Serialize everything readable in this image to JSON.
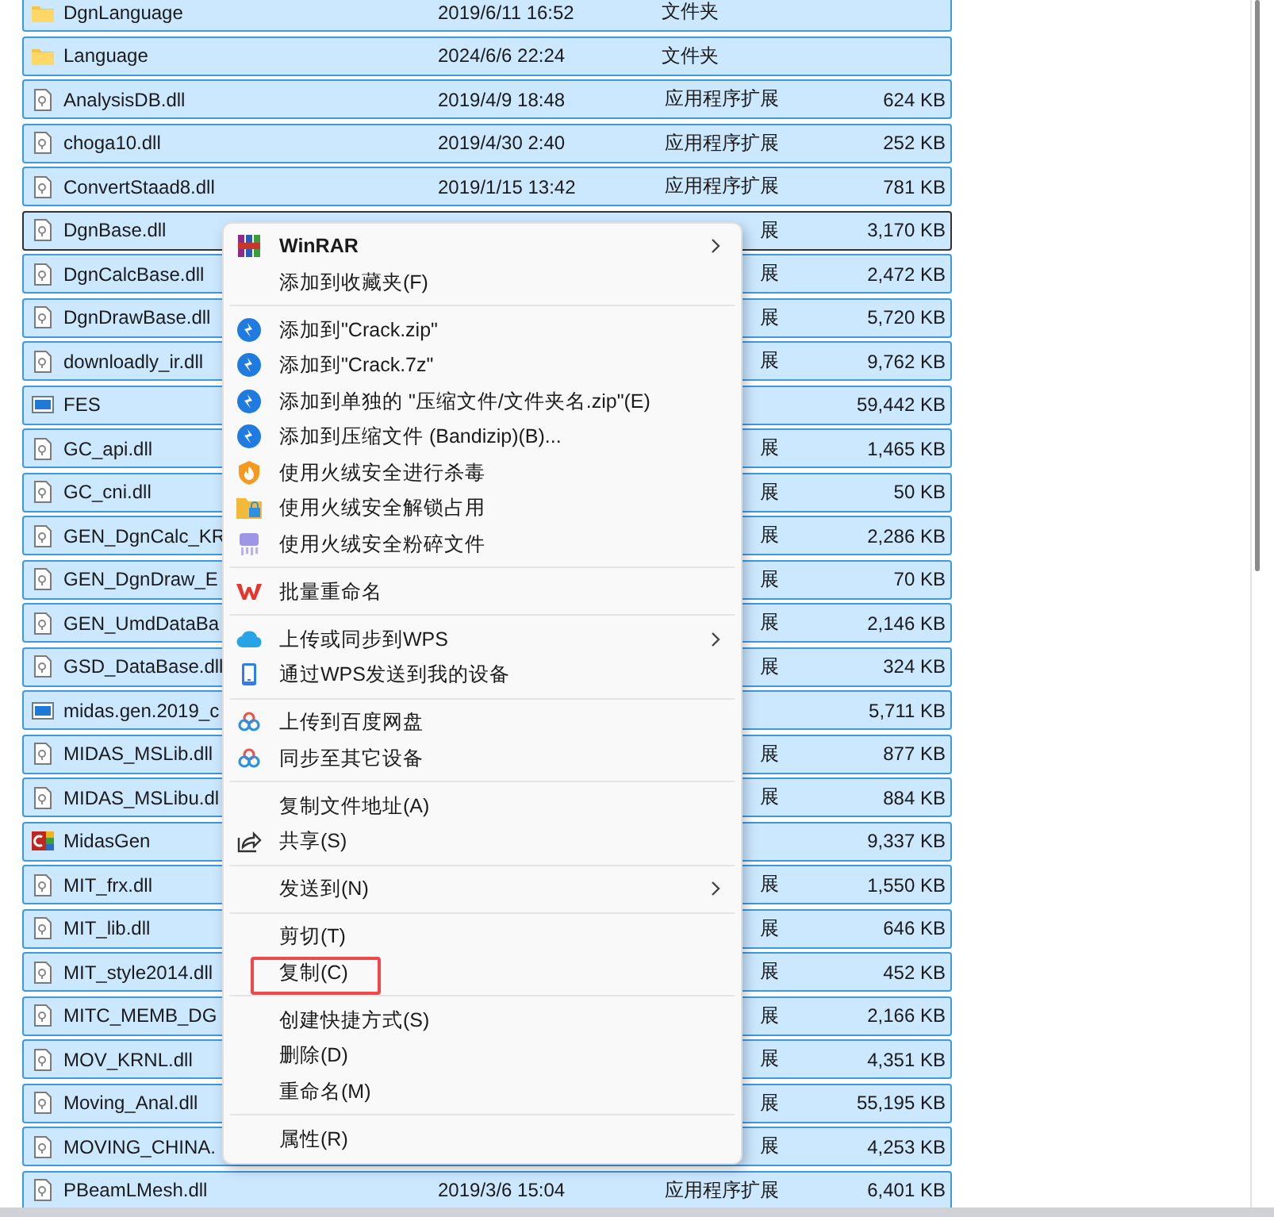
{
  "files": [
    {
      "name": "DgnLanguage",
      "date": "2019/6/11 16:52",
      "type": "文件夹",
      "kind": "folder",
      "selected": true,
      "focused": false
    },
    {
      "name": "Language",
      "date": "2024/6/6 22:24",
      "type": "文件夹",
      "kind": "folder",
      "selected": true,
      "focused": false
    },
    {
      "name": "AnalysisDB.dll",
      "date": "2019/4/9 18:48",
      "type": "应用程序扩展",
      "size": "624 KB",
      "kind": "dll",
      "selected": true,
      "focused": false
    },
    {
      "name": "choga10.dll",
      "date": "2019/4/30 2:40",
      "type": "应用程序扩展",
      "size": "252 KB",
      "kind": "dll",
      "selected": true,
      "focused": false
    },
    {
      "name": "ConvertStaad8.dll",
      "date": "2019/1/15 13:42",
      "type": "应用程序扩展",
      "size": "781 KB",
      "kind": "dll",
      "selected": true,
      "focused": false
    },
    {
      "name": "DgnBase.dll",
      "type": "展",
      "size": "3,170 KB",
      "kind": "dll",
      "selected": true,
      "focused": true
    },
    {
      "name": "DgnCalcBase.dll",
      "type": "展",
      "size": "2,472 KB",
      "kind": "dll",
      "selected": true,
      "focused": false
    },
    {
      "name": "DgnDrawBase.dll",
      "type": "展",
      "size": "5,720 KB",
      "kind": "dll",
      "selected": true,
      "focused": false
    },
    {
      "name": "downloadly_ir.dll",
      "type": "展",
      "size": "9,762 KB",
      "kind": "dll",
      "selected": true,
      "focused": false
    },
    {
      "name": "FES",
      "size": "59,442 KB",
      "kind": "app",
      "selected": true,
      "focused": false
    },
    {
      "name": "GC_api.dll",
      "type": "展",
      "size": "1,465 KB",
      "kind": "dll",
      "selected": true,
      "focused": false
    },
    {
      "name": "GC_cni.dll",
      "type": "展",
      "size": "50 KB",
      "kind": "dll",
      "selected": true,
      "focused": false
    },
    {
      "name": "GEN_DgnCalc_KR",
      "type": "展",
      "size": "2,286 KB",
      "kind": "dll",
      "selected": true,
      "focused": false
    },
    {
      "name": "GEN_DgnDraw_E",
      "type": "展",
      "size": "70 KB",
      "kind": "dll",
      "selected": true,
      "focused": false
    },
    {
      "name": "GEN_UmdDataBa",
      "type": "展",
      "size": "2,146 KB",
      "kind": "dll",
      "selected": true,
      "focused": false
    },
    {
      "name": "GSD_DataBase.dll",
      "type": "展",
      "size": "324 KB",
      "kind": "dll",
      "selected": true,
      "focused": false
    },
    {
      "name": "midas.gen.2019_c",
      "size": "5,711 KB",
      "kind": "app",
      "selected": true,
      "focused": false
    },
    {
      "name": "MIDAS_MSLib.dll",
      "type": "展",
      "size": "877 KB",
      "kind": "dll",
      "selected": true,
      "focused": false
    },
    {
      "name": "MIDAS_MSLibu.dl",
      "type": "展",
      "size": "884 KB",
      "kind": "dll",
      "selected": true,
      "focused": false
    },
    {
      "name": "MidasGen",
      "size": "9,337 KB",
      "kind": "midas",
      "selected": true,
      "focused": false
    },
    {
      "name": "MIT_frx.dll",
      "type": "展",
      "size": "1,550 KB",
      "kind": "dll",
      "selected": true,
      "focused": false
    },
    {
      "name": "MIT_lib.dll",
      "type": "展",
      "size": "646 KB",
      "kind": "dll",
      "selected": true,
      "focused": false
    },
    {
      "name": "MIT_style2014.dll",
      "type": "展",
      "size": "452 KB",
      "kind": "dll",
      "selected": true,
      "focused": false
    },
    {
      "name": "MITC_MEMB_DG",
      "type": "展",
      "size": "2,166 KB",
      "kind": "dll",
      "selected": true,
      "focused": false
    },
    {
      "name": "MOV_KRNL.dll",
      "type": "展",
      "size": "4,351 KB",
      "kind": "dll",
      "selected": true,
      "focused": false
    },
    {
      "name": "Moving_Anal.dll",
      "type": "展",
      "size": "55,195 KB",
      "kind": "dll",
      "selected": true,
      "focused": false
    },
    {
      "name": "MOVING_CHINA.",
      "type": "展",
      "size": "4,253 KB",
      "kind": "dll",
      "selected": true,
      "focused": false
    },
    {
      "name": "PBeamLMesh.dll",
      "date": "2019/3/6 15:04",
      "type": "应用程序扩展",
      "size": "6,401 KB",
      "kind": "dll",
      "selected": true,
      "focused": false
    }
  ],
  "context_menu": [
    {
      "kind": "item",
      "label": "WinRAR",
      "bold": true,
      "submenu": true,
      "outlined": false
    },
    {
      "kind": "item",
      "label": "添加到收藏夹(F)",
      "bold": false,
      "submenu": false,
      "outlined": false
    },
    {
      "kind": "separator"
    },
    {
      "kind": "item",
      "label": "添加到\"Crack.zip\"",
      "bold": false,
      "submenu": false,
      "outlined": false
    },
    {
      "kind": "item",
      "label": "添加到\"Crack.7z\"",
      "bold": false,
      "submenu": false,
      "outlined": false
    },
    {
      "kind": "item",
      "label": "添加到单独的 \"压缩文件/文件夹名.zip\"(E)",
      "bold": false,
      "submenu": false,
      "outlined": false
    },
    {
      "kind": "item",
      "label": "添加到压缩文件 (Bandizip)(B)...",
      "bold": false,
      "submenu": false,
      "outlined": false
    },
    {
      "kind": "item",
      "label": "使用火绒安全进行杀毒",
      "bold": false,
      "submenu": false,
      "outlined": false
    },
    {
      "kind": "item",
      "label": "使用火绒安全解锁占用",
      "bold": false,
      "submenu": false,
      "outlined": false
    },
    {
      "kind": "item",
      "label": "使用火绒安全粉碎文件",
      "bold": false,
      "submenu": false,
      "outlined": false
    },
    {
      "kind": "separator"
    },
    {
      "kind": "item",
      "label": "批量重命名",
      "bold": false,
      "submenu": false,
      "outlined": false
    },
    {
      "kind": "separator"
    },
    {
      "kind": "item",
      "label": "上传或同步到WPS",
      "bold": false,
      "submenu": true,
      "outlined": false
    },
    {
      "kind": "item",
      "label": "通过WPS发送到我的设备",
      "bold": false,
      "submenu": false,
      "outlined": false
    },
    {
      "kind": "separator"
    },
    {
      "kind": "item",
      "label": "上传到百度网盘",
      "bold": false,
      "submenu": false,
      "outlined": false
    },
    {
      "kind": "item",
      "label": "同步至其它设备",
      "bold": false,
      "submenu": false,
      "outlined": false
    },
    {
      "kind": "separator"
    },
    {
      "kind": "item",
      "label": "复制文件地址(A)",
      "bold": false,
      "submenu": false,
      "outlined": false
    },
    {
      "kind": "item",
      "label": "共享(S)",
      "bold": false,
      "submenu": false,
      "outlined": false
    },
    {
      "kind": "separator"
    },
    {
      "kind": "item",
      "label": "发送到(N)",
      "bold": false,
      "submenu": true,
      "outlined": false
    },
    {
      "kind": "separator"
    },
    {
      "kind": "item",
      "label": "剪切(T)",
      "bold": false,
      "submenu": false,
      "outlined": false
    },
    {
      "kind": "item",
      "label": "复制(C)",
      "bold": false,
      "submenu": false,
      "outlined": true
    },
    {
      "kind": "separator"
    },
    {
      "kind": "item",
      "label": "创建快捷方式(S)",
      "bold": false,
      "submenu": false,
      "outlined": false
    },
    {
      "kind": "item",
      "label": "删除(D)",
      "bold": false,
      "submenu": false,
      "outlined": false
    },
    {
      "kind": "item",
      "label": "重命名(M)",
      "bold": false,
      "submenu": false,
      "outlined": false
    },
    {
      "kind": "separator"
    },
    {
      "kind": "item",
      "label": "属性(R)",
      "bold": false,
      "submenu": false,
      "outlined": false
    }
  ]
}
